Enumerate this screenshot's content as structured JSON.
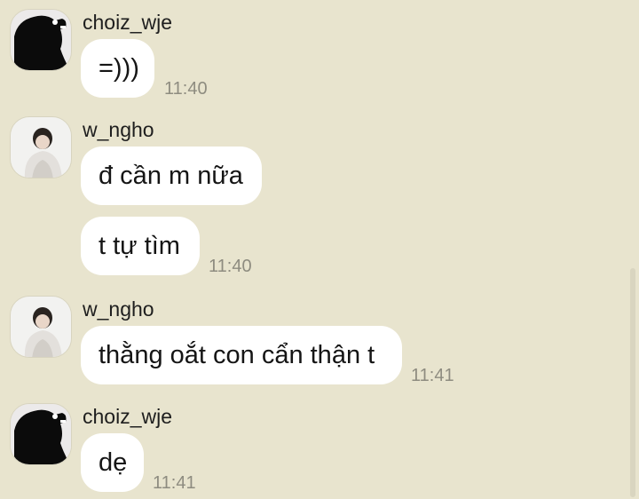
{
  "messages": [
    {
      "sender": "choiz_wje",
      "text": "=)))",
      "time": "11:40"
    },
    {
      "sender": "w_ngho",
      "text": "đ cần m nữa"
    },
    {
      "text": "t tự tìm",
      "time": "11:40"
    },
    {
      "sender": "w_ngho",
      "text": "thằng oắt con cẩn thận t",
      "time": "11:41"
    },
    {
      "sender": "choiz_wje",
      "text": "dẹ",
      "time": "11:41"
    }
  ],
  "colors": {
    "background": "#e8e4ce",
    "bubble": "#ffffff",
    "time_text": "#8e8c80"
  }
}
